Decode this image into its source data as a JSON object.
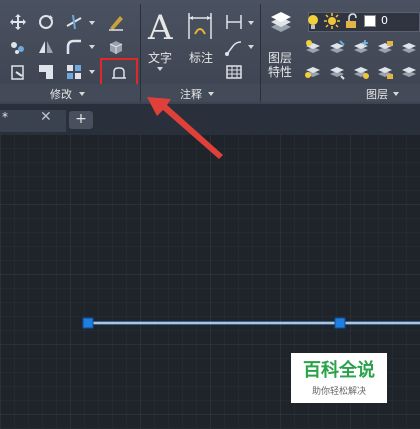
{
  "ribbon": {
    "modify_panel": {
      "title": "修改"
    },
    "annotation_panel": {
      "title": "注释",
      "text_label": "文字",
      "dimension_label": "标注"
    },
    "layers_panel": {
      "title": "图层",
      "properties_label_line1": "图层",
      "properties_label_line2": "特性",
      "current_layer": "0"
    }
  },
  "tabs": {
    "current_tab_marker": "*",
    "close_symbol": "✕",
    "add_symbol": "+"
  },
  "watermark": {
    "main": "百科全说",
    "sub": "助你轻松解决"
  },
  "colors": {
    "highlight": "#e12828",
    "arrow": "#e0403a",
    "line": "#8fc8ff",
    "grip": "#1f7fe0",
    "watermark_green": "#2aa24a"
  }
}
